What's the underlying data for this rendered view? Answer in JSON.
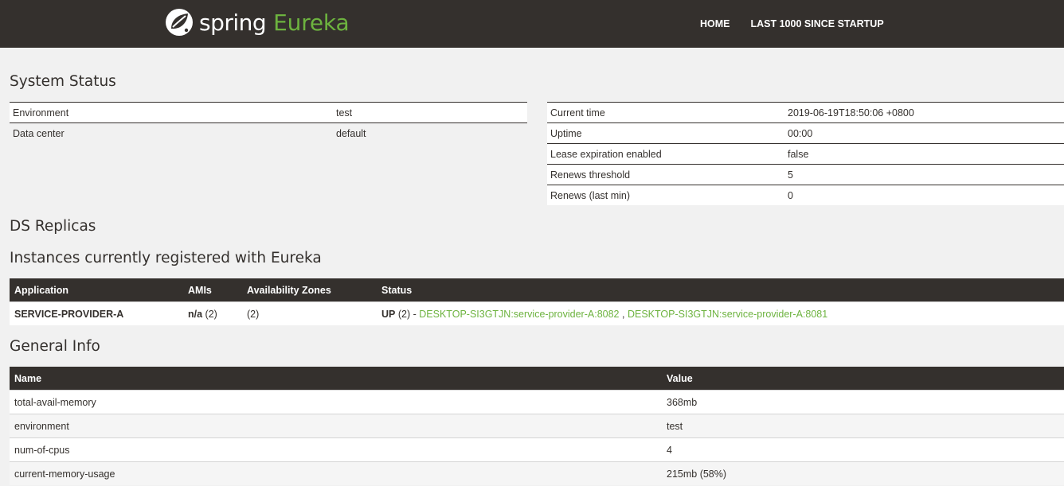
{
  "header": {
    "brand_spring": "spring",
    "brand_eureka": "Eureka",
    "nav": [
      {
        "label": "HOME"
      },
      {
        "label": "LAST 1000 SINCE STARTUP"
      }
    ]
  },
  "system_status": {
    "title": "System Status",
    "environment_rows": [
      {
        "label": "Environment",
        "value": "test"
      },
      {
        "label": "Data center",
        "value": "default"
      }
    ],
    "status_rows": [
      {
        "label": "Current time",
        "value": "2019-06-19T18:50:06 +0800"
      },
      {
        "label": "Uptime",
        "value": "00:00"
      },
      {
        "label": "Lease expiration enabled",
        "value": "false"
      },
      {
        "label": "Renews threshold",
        "value": "5"
      },
      {
        "label": "Renews (last min)",
        "value": "0"
      }
    ]
  },
  "ds_replicas": {
    "title": "DS Replicas"
  },
  "instances": {
    "title": "Instances currently registered with Eureka",
    "headers": [
      "Application",
      "AMIs",
      "Availability Zones",
      "Status"
    ],
    "rows": [
      {
        "application": "SERVICE-PROVIDER-A",
        "amis_bold": "n/a",
        "amis_count": "(2)",
        "zones": "(2)",
        "status_bold": "UP",
        "status_count": "(2) -",
        "instance_1": "DESKTOP-SI3GTJN:service-provider-A:8082",
        "separator": ",",
        "instance_2": "DESKTOP-SI3GTJN:service-provider-A:8081"
      }
    ]
  },
  "general_info": {
    "title": "General Info",
    "headers": [
      "Name",
      "Value"
    ],
    "rows": [
      {
        "name": "total-avail-memory",
        "value": "368mb"
      },
      {
        "name": "environment",
        "value": "test"
      },
      {
        "name": "num-of-cpus",
        "value": "4"
      },
      {
        "name": "current-memory-usage",
        "value": "215mb (58%)"
      }
    ]
  },
  "colors": {
    "navbar": "#34302d",
    "accent": "#6db33f",
    "background": "#f1f1f1"
  }
}
